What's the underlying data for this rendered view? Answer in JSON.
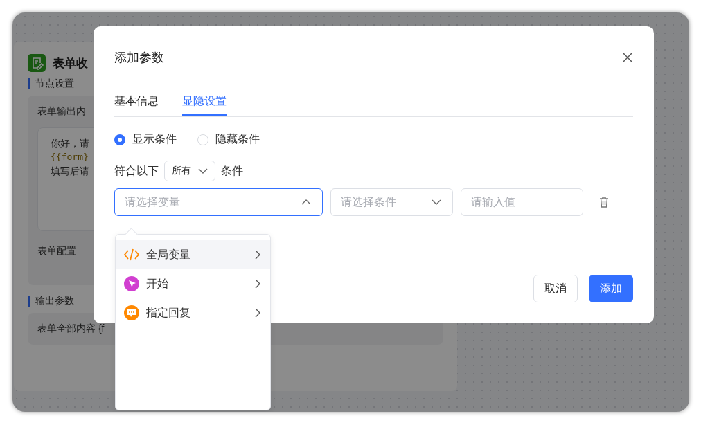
{
  "background_panel": {
    "title": "表单收",
    "node_settings_label": "节点设置",
    "output_content_label": "表单输出内",
    "template_lines": [
      "你好，请",
      "{{form}",
      "填写后请"
    ],
    "form_config_label": "表单配置",
    "output_params_label": "输出参数",
    "output_value": "表单全部内容 {f"
  },
  "dialog": {
    "title": "添加参数",
    "tabs": [
      {
        "label": "基本信息",
        "selected": false
      },
      {
        "label": "显隐设置",
        "selected": true
      }
    ],
    "visibility": [
      {
        "label": "显示条件",
        "selected": true
      },
      {
        "label": "隐藏条件",
        "selected": false
      }
    ],
    "match": {
      "prefix": "符合以下",
      "mode": "所有",
      "suffix": "条件"
    },
    "condition": {
      "variable_placeholder": "请选择变量",
      "expanded": true,
      "condition_placeholder": "请选择条件",
      "value_placeholder": "请输入值"
    },
    "buttons": [
      {
        "label": "取消",
        "kind": "secondary"
      },
      {
        "label": "添加",
        "kind": "primary"
      }
    ]
  },
  "variable_menu": [
    {
      "label": "全局变量",
      "kind": "code",
      "highlighted": true
    },
    {
      "label": "开始",
      "kind": "start",
      "highlighted": false
    },
    {
      "label": "指定回复",
      "kind": "reply",
      "highlighted": false
    }
  ]
}
